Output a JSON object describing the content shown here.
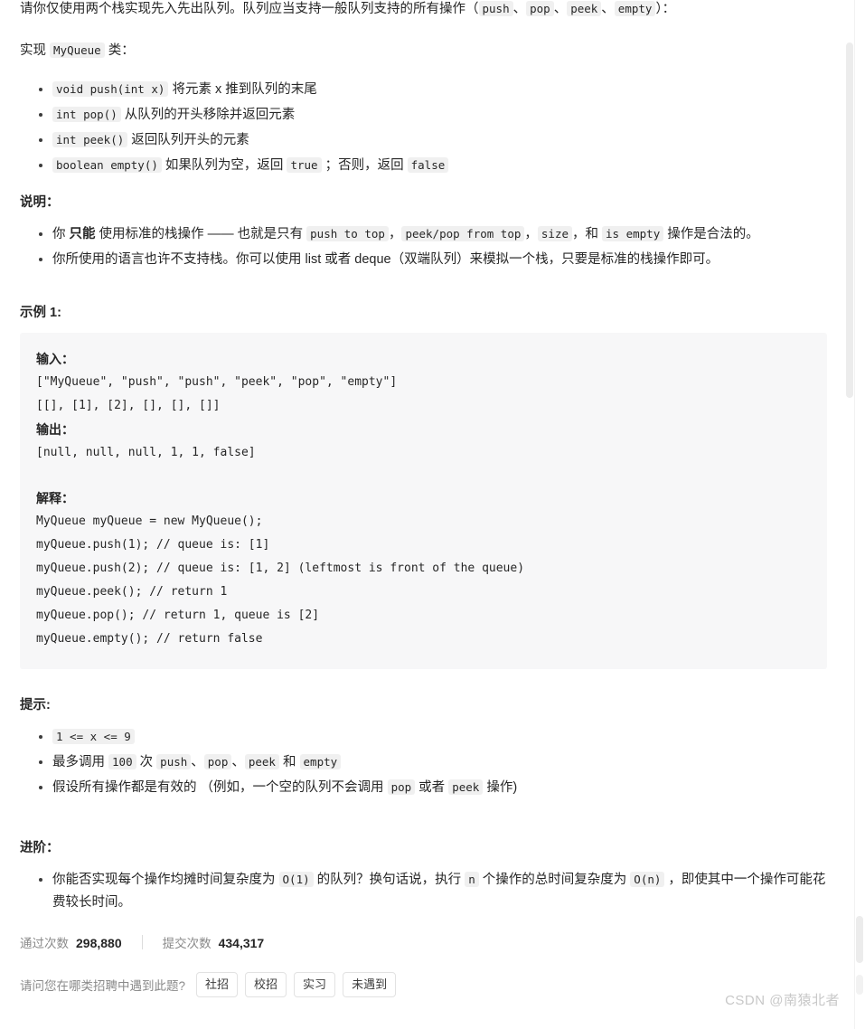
{
  "problem": {
    "intro": {
      "prefix": "请你仅使用两个栈实现先入先出队列。队列应当支持一般队列支持的所有操作（",
      "ops": [
        "push",
        "pop",
        "peek",
        "empty"
      ],
      "separator": "、",
      "suffix": "）："
    },
    "implement_line": {
      "before": "实现",
      "code": "MyQueue",
      "after": "类："
    },
    "method_list": [
      {
        "code": "void push(int x)",
        "desc": "将元素 x 推到队列的末尾"
      },
      {
        "code": "int pop()",
        "desc": "从队列的开头移除并返回元素"
      },
      {
        "code": "int peek()",
        "desc": "返回队列开头的元素"
      },
      {
        "code": "boolean empty()",
        "desc_a": "如果队列为空，返回",
        "code_true": "true",
        "desc_b": "；否则，返回",
        "code_false": "false"
      }
    ],
    "notes_title": "说明：",
    "notes": [
      {
        "a": "你 ",
        "strong": "只能",
        "b": " 使用标准的栈操作 —— 也就是只有 ",
        "codes": [
          "push to top",
          "peek/pop from top",
          "size"
        ],
        "c": "，和 ",
        "code_last": "is empty",
        "d": " 操作是合法的。"
      },
      {
        "plain": "你所使用的语言也许不支持栈。你可以使用 list 或者 deque（双端队列）来模拟一个栈，只要是标准的栈操作即可。"
      }
    ],
    "example_title": "示例 1:",
    "example": {
      "input_label": "输入：",
      "input_lines": [
        "[\"MyQueue\", \"push\", \"push\", \"peek\", \"pop\", \"empty\"]",
        "[[], [1], [2], [], [], []]"
      ],
      "output_label": "输出：",
      "output_lines": [
        "[null, null, null, 1, 1, false]"
      ],
      "explain_label": "解释：",
      "explain_lines": [
        "MyQueue myQueue = new MyQueue();",
        "myQueue.push(1); // queue is: [1]",
        "myQueue.push(2); // queue is: [1, 2] (leftmost is front of the queue)",
        "myQueue.peek(); // return 1",
        "myQueue.pop(); // return 1, queue is [2]",
        "myQueue.empty(); // return false"
      ]
    },
    "hints_title": "提示:",
    "hints": [
      {
        "only_code": "1 <= x <= 9"
      },
      {
        "a": "最多调用 ",
        "code_num": "100",
        "b": " 次 ",
        "codes": [
          "push",
          "pop",
          "peek"
        ],
        "sep": "、",
        "c": " 和 ",
        "code_last": "empty"
      },
      {
        "a": "假设所有操作都是有效的 （例如，一个空的队列不会调用 ",
        "code1": "pop",
        "b": " 或者 ",
        "code2": "peek",
        "c": " 操作)"
      }
    ],
    "advanced_title": "进阶：",
    "advanced": {
      "a": "你能否实现每个操作均摊时间复杂度为 ",
      "code1": "O(1)",
      "b": " 的队列？换句话说，执行 ",
      "code2": "n",
      "c": " 个操作的总时间复杂度为 ",
      "code3": "O(n)",
      "d": " ，即使其中一个操作可能花费较长时间。"
    }
  },
  "stats": {
    "accepted_label": "通过次数",
    "accepted_value": "298,880",
    "submissions_label": "提交次数",
    "submissions_value": "434,317"
  },
  "poll": {
    "question": "请问您在哪类招聘中遇到此题?",
    "options": [
      "社招",
      "校招",
      "实习",
      "未遇到"
    ]
  },
  "watermark": "CSDN @南猿北者",
  "colors": {
    "text": "#262626",
    "muted": "#8a8a8a",
    "code_bg": "#f0f0f0",
    "block_bg": "#f7f7f8",
    "border": "#e2e2e2",
    "scrollbar": "#ececec"
  }
}
